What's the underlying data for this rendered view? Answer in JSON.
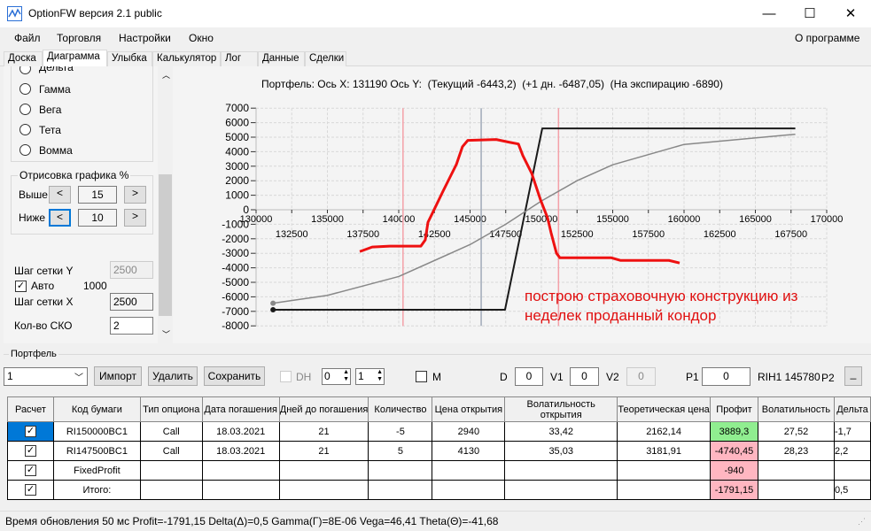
{
  "window": {
    "title": "OptionFW версия 2.1 public",
    "minimize": "—",
    "maximize": "☐",
    "close": "✕"
  },
  "menu": {
    "items": [
      "Файл",
      "Торговля",
      "Настройки",
      "Окно"
    ],
    "about": "О программе"
  },
  "tabs": [
    "Доска",
    "Диаграмма",
    "Улыбка",
    "Калькулятор",
    "Лог",
    "Данные",
    "Сделки"
  ],
  "left_panel": {
    "radios": [
      "Дельта",
      "Гамма",
      "Вега",
      "Тета",
      "Вомма"
    ],
    "draw_group": {
      "title": "Отрисовка графика %",
      "above_label": "Выше",
      "above_value": "15",
      "below_label": "Ниже",
      "below_value": "10",
      "dec": "<",
      "inc": ">"
    },
    "grid_y_label": "Шаг сетки Y",
    "grid_y_value": "2500",
    "auto_label": "Авто",
    "auto_checked": true,
    "auto_value": "1000",
    "grid_x_label": "Шаг сетки X",
    "grid_x_value": "2500",
    "sko_label": "Кол-во СКО",
    "sko_value": "2"
  },
  "chart_data": {
    "type": "line",
    "title": "Портфель: Ось X: 131190 Ось Y:  (Текущий -6443,2)  (+1 дн. -6487,05)  (На экспирацию -6890)",
    "xlim": [
      130000,
      170000
    ],
    "ylim": [
      -8000,
      7000
    ],
    "grid": true,
    "x_ticks_upper": [
      "130000",
      "135000",
      "140000",
      "145000",
      "150000",
      "155000",
      "160000",
      "165000",
      "170000"
    ],
    "x_ticks_lower": [
      "132500",
      "137500",
      "142500",
      "147500",
      "152500",
      "157500",
      "162500",
      "167500"
    ],
    "y_ticks": [
      "7000",
      "6000",
      "5000",
      "4000",
      "3000",
      "2000",
      "1000",
      "0",
      "-1000",
      "-2000",
      "-3000",
      "-4000",
      "-5000",
      "-6000",
      "-7000",
      "-8000"
    ],
    "vertical_lines": [
      {
        "x": 140300,
        "color": "#f4a0a8"
      },
      {
        "x": 145780,
        "color": "#a0aab8"
      },
      {
        "x": 151200,
        "color": "#f4a0a8"
      }
    ],
    "series": [
      {
        "name": "expiration",
        "color": "#1a1a1a",
        "points": [
          [
            131190,
            -6890
          ],
          [
            147450,
            -6890
          ],
          [
            150060,
            5600
          ],
          [
            167800,
            5600
          ]
        ]
      },
      {
        "name": "current",
        "color": "#888888",
        "points": [
          [
            131190,
            -6443
          ],
          [
            135000,
            -5900
          ],
          [
            140000,
            -4600
          ],
          [
            145000,
            -2400
          ],
          [
            147500,
            -1000
          ],
          [
            150000,
            600
          ],
          [
            152500,
            2000
          ],
          [
            155000,
            3100
          ],
          [
            160000,
            4500
          ],
          [
            167800,
            5200
          ]
        ]
      },
      {
        "name": "hand-drawn",
        "color": "#ee1111",
        "points": [
          [
            137270,
            -2880
          ],
          [
            138140,
            -2570
          ],
          [
            139380,
            -2510
          ],
          [
            141550,
            -2510
          ],
          [
            141860,
            -2080
          ],
          [
            142050,
            -860
          ],
          [
            142360,
            -240
          ],
          [
            143110,
            1290
          ],
          [
            144040,
            3120
          ],
          [
            144470,
            4350
          ],
          [
            144840,
            4780
          ],
          [
            146830,
            4840
          ],
          [
            147760,
            4650
          ],
          [
            148390,
            4530
          ],
          [
            148700,
            3730
          ],
          [
            149320,
            2510
          ],
          [
            149940,
            680
          ],
          [
            150430,
            -550
          ],
          [
            150680,
            -1590
          ],
          [
            151060,
            -3000
          ],
          [
            151300,
            -3310
          ],
          [
            154910,
            -3310
          ],
          [
            155530,
            -3490
          ],
          [
            158940,
            -3490
          ],
          [
            159690,
            -3670
          ]
        ]
      }
    ],
    "annotation": [
      "построю страховочную конструкцию из",
      "неделек проданный кондор"
    ]
  },
  "portfolio": {
    "title": "Портфель",
    "select_value": "1",
    "import": "Импорт",
    "delete": "Удалить",
    "save": "Сохранить",
    "dh_label": "DH",
    "spin1": "0",
    "spin2": "1",
    "m_label": "M",
    "d_label": "D",
    "d_value": "0",
    "v1_label": "V1",
    "v1_value": "0",
    "v2_label": "V2",
    "v2_value": "0",
    "p1_label": "P1",
    "p1_value": "0",
    "instrument": "RIH1 145780",
    "p2_label": "P2",
    "p2_btn": "_",
    "columns": [
      "Расчет",
      "Код бумаги",
      "Тип опциона",
      "Дата погашения",
      "Дней до погашения",
      "Количество",
      "Цена открытия",
      "Волатильность открытия",
      "Теоретическая цена",
      "Профит",
      "Волатильность",
      "Дельта"
    ],
    "rows": [
      {
        "code": "RI150000BC1",
        "type": "Call",
        "date": "18.03.2021",
        "days": "21",
        "qty": "-5",
        "price": "2940",
        "vol_open": "33,42",
        "theor": "2162,14",
        "profit": "3889,3",
        "profit_color": "#90ee90",
        "vol": "27,52",
        "delta": "-1,7"
      },
      {
        "code": "RI147500BC1",
        "type": "Call",
        "date": "18.03.2021",
        "days": "21",
        "qty": "5",
        "price": "4130",
        "vol_open": "35,03",
        "theor": "3181,91",
        "profit": "-4740,45",
        "profit_color": "#ffb6c1",
        "vol": "28,23",
        "delta": "2,2"
      },
      {
        "code": "FixedProfit",
        "type": "",
        "date": "",
        "days": "",
        "qty": "",
        "price": "",
        "vol_open": "",
        "theor": "",
        "profit": "-940",
        "profit_color": "#ffb6c1",
        "vol": "",
        "delta": ""
      },
      {
        "code": "Итого:",
        "type": "",
        "date": "",
        "days": "",
        "qty": "",
        "price": "",
        "vol_open": "",
        "theor": "",
        "profit": "-1791,15",
        "profit_color": "#ffb6c1",
        "vol": "",
        "delta": "0,5"
      }
    ]
  },
  "status": "Время обновления 50 мс  Profit=-1791,15 Delta(Δ)=0,5 Gamma(Γ)=8E-06 Vega=46,41 Theta(Θ)=-41,68"
}
